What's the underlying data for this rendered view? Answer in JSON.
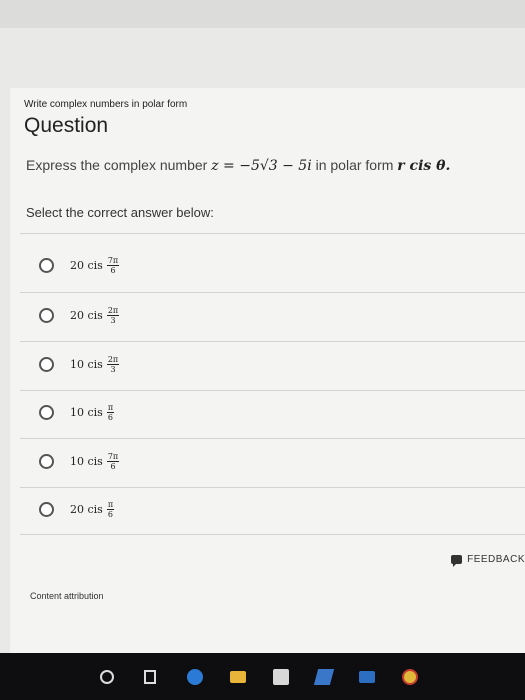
{
  "card": {
    "subtitle": "Write complex numbers in polar form",
    "title": "Question",
    "prompt_text": "Express the complex number",
    "prompt_math": "z = −5√3 − 5i",
    "prompt_mid": "in polar form",
    "prompt_form": "r cis θ.",
    "instruction": "Select the correct answer below:"
  },
  "options": [
    {
      "coef": "20 cis",
      "num": "7π",
      "den": "6"
    },
    {
      "coef": "20 cis",
      "num": "2π",
      "den": "3"
    },
    {
      "coef": "10 cis",
      "num": "2π",
      "den": "3"
    },
    {
      "coef": "10 cis",
      "num": "π",
      "den": "6"
    },
    {
      "coef": "10 cis",
      "num": "7π",
      "den": "6"
    },
    {
      "coef": "20 cis",
      "num": "π",
      "den": "6"
    }
  ],
  "feedback_label": "FEEDBACK",
  "attribution": "Content attribution",
  "taskbar_icons": [
    "cortana-icon",
    "task-view-icon",
    "edge-icon",
    "file-explorer-icon",
    "store-icon",
    "visual-studio-icon",
    "mail-icon",
    "chrome-icon"
  ]
}
